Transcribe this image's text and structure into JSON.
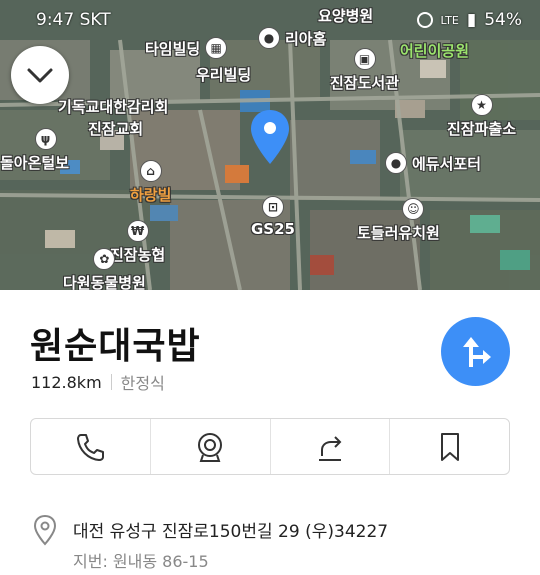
{
  "status_bar": {
    "time": "9:47",
    "carrier": "SKT",
    "battery": "54%",
    "network": "LTE"
  },
  "map": {
    "pois": [
      {
        "id": "youngyang",
        "label": "요양병원"
      },
      {
        "id": "time_bldg",
        "label": "타임빌딩"
      },
      {
        "id": "riahum",
        "label": "리아홈"
      },
      {
        "id": "kindergarten",
        "label": "어린이공원"
      },
      {
        "id": "uri_bldg",
        "label": "우리빌딩"
      },
      {
        "id": "library",
        "label": "진잠도서관"
      },
      {
        "id": "council",
        "label": "기독교대한감리회"
      },
      {
        "id": "church",
        "label": "진잠교회"
      },
      {
        "id": "police",
        "label": "진잠파출소"
      },
      {
        "id": "restaurant",
        "label": "돌아온털보"
      },
      {
        "id": "edu",
        "label": "에듀서포터"
      },
      {
        "id": "harangvill",
        "label": "하랑빌"
      },
      {
        "id": "gs25",
        "label": "GS25"
      },
      {
        "id": "toddler",
        "label": "토들러유치원"
      },
      {
        "id": "nonghyup",
        "label": "진잠농협"
      },
      {
        "id": "animal",
        "label": "다원동물병원"
      }
    ]
  },
  "place": {
    "name": "원순대국밥",
    "distance": "112.8km",
    "category": "한정식"
  },
  "actions": {
    "call_icon": "phone-icon",
    "camera_icon": "camera-icon",
    "share_icon": "share-icon",
    "save_icon": "bookmark-icon"
  },
  "address": {
    "road": "대전 유성구 진잠로150번길 29 (우)34227",
    "lot": "지번: 원내동 86-15"
  },
  "colors": {
    "accent": "#3d8ff7"
  }
}
